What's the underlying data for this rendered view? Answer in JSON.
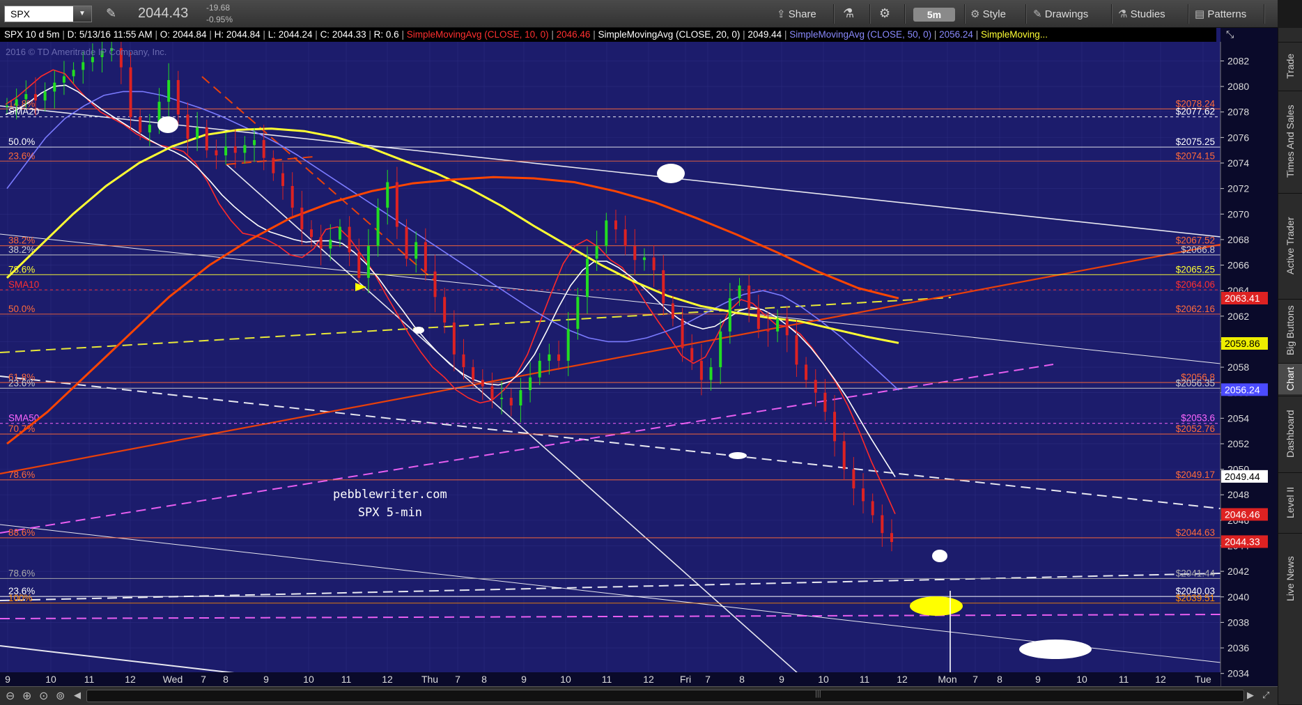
{
  "toolbar": {
    "symbol": "SPX",
    "last_price": "2044.43",
    "change": "-19.68",
    "change_pct": "-0.95%",
    "share_label": "Share",
    "interval_label": "5m",
    "style_label": "Style",
    "drawings_label": "Drawings",
    "studies_label": "Studies",
    "patterns_label": "Patterns"
  },
  "header": {
    "text": "SPX 10 d 5m",
    "date": "D: 5/13/16 11:55 AM",
    "open": "O: 2044.84",
    "high": "H: 2044.84",
    "low": "L: 2044.24",
    "close": "C: 2044.33",
    "range": "R: 0.6",
    "sma10_label": "SimpleMovingAvg (CLOSE, 10, 0)",
    "sma10_value": "2046.46",
    "sma20_label": "SimpleMovingAvg (CLOSE, 20, 0)",
    "sma20_value": "2049.44",
    "sma50_label": "SimpleMovingAvg (CLOSE, 50, 0)",
    "sma50_value": "2056.24",
    "sma_more": "SimpleMoving..."
  },
  "copyright": "2016 © TD Ameritrade IP Company, Inc.",
  "watermark": {
    "line1": "pebblewriter.com",
    "line2": "SPX 5-min"
  },
  "colors": {
    "background": "#1c1c6c",
    "sma10": "#ff2a2a",
    "sma20": "#ffffff",
    "sma50": "#7b7bff",
    "sma100": "#ffff33",
    "sma200": "#ff4500",
    "fib_line": "#ff6a3a",
    "magenta": "#ff66ff"
  },
  "side_tabs": [
    "Trade",
    "Times And Sales",
    "Active Trader",
    "Big Buttons",
    "Chart",
    "Dashboard",
    "Level II",
    "Live News"
  ],
  "active_side_tab": "Chart",
  "chart_data": {
    "type": "line",
    "title": "SPX 10 d 5m",
    "y_ticks": [
      "2082",
      "2080",
      "2078",
      "2076",
      "2074",
      "2072",
      "2070",
      "2068",
      "2066",
      "2064",
      "2062",
      "2060",
      "2058",
      "2056",
      "2054",
      "2052",
      "2050",
      "2048",
      "2046",
      "2044",
      "2042",
      "2040",
      "2038",
      "2036",
      "2034"
    ],
    "ylim": [
      2033.0,
      2083.5
    ],
    "x_ticks": [
      "9",
      "10",
      "11",
      "12",
      "Wed",
      "7",
      "8",
      "9",
      "10",
      "11",
      "12",
      "Thu",
      "7",
      "8",
      "9",
      "10",
      "11",
      "12",
      "Fri",
      "7",
      "8",
      "9",
      "10",
      "11",
      "12",
      "Mon",
      "7",
      "8",
      "9",
      "10",
      "11",
      "12",
      "Tue"
    ],
    "price_tags": [
      {
        "value": 2063.41,
        "label": "2063.41",
        "color": "#dd2222"
      },
      {
        "value": 2059.86,
        "label": "2059.86",
        "color": "#eeee00"
      },
      {
        "value": 2056.24,
        "label": "2056.24",
        "color": "#4b4bff"
      },
      {
        "value": 2049.44,
        "label": "2049.44",
        "color": "#ffffff"
      },
      {
        "value": 2046.46,
        "label": "2046.46",
        "color": "#dd2222"
      },
      {
        "value": 2044.33,
        "label": "2044.33",
        "color": "#dd2222"
      }
    ],
    "levels": [
      {
        "value": 2078.24,
        "label": "$2078.24",
        "left_label": "14.8%",
        "color": "#ff6a3a",
        "dash": false
      },
      {
        "value": 2077.62,
        "label": "$2077.62",
        "left_label": "SMA20",
        "color": "#ffffff",
        "dash": true
      },
      {
        "value": 2075.25,
        "label": "$2075.25",
        "left_label": "50.0%",
        "color": "#ffffff",
        "dash": false
      },
      {
        "value": 2074.15,
        "label": "$2074.15",
        "left_label": "23.6%",
        "color": "#ff6a3a",
        "dash": false
      },
      {
        "value": 2067.52,
        "label": "$2067.52",
        "left_label": "38.2%",
        "color": "#ff6a3a",
        "dash": false
      },
      {
        "value": 2066.8,
        "label": "$2066.8",
        "left_label": "38.2%",
        "color": "#cccccc",
        "dash": false
      },
      {
        "value": 2065.25,
        "label": "$2065.25",
        "left_label": "78.6%",
        "color": "#ffff33",
        "dash": false
      },
      {
        "value": 2064.06,
        "label": "$2064.06",
        "left_label": "SMA10",
        "color": "#ff3030",
        "dash": true
      },
      {
        "value": 2062.16,
        "label": "$2062.16",
        "left_label": "50.0%",
        "color": "#ff6a3a",
        "dash": false
      },
      {
        "value": 2056.8,
        "label": "$2056.8",
        "left_label": "61.8%",
        "color": "#ff6a3a",
        "dash": false
      },
      {
        "value": 2056.35,
        "label": "$2056.35",
        "left_label": "23.6%",
        "color": "#cccccc",
        "dash": false
      },
      {
        "value": 2053.6,
        "label": "$2053.6",
        "left_label": "SMA50",
        "color": "#ff66ff",
        "dash": true
      },
      {
        "value": 2052.76,
        "label": "$2052.76",
        "left_label": "70.7%",
        "color": "#ff6a3a",
        "dash": false
      },
      {
        "value": 2049.17,
        "label": "$2049.17",
        "left_label": "78.6%",
        "color": "#ff6a3a",
        "dash": false
      },
      {
        "value": 2044.63,
        "label": "$2044.63",
        "left_label": "88.6%",
        "color": "#ff6a3a",
        "dash": false
      },
      {
        "value": 2041.44,
        "label": "$2041.44",
        "left_label": "78.6%",
        "color": "#aaaaaa",
        "dash": false
      },
      {
        "value": 2040.03,
        "label": "$2040.03",
        "left_label": "23.6%",
        "color": "#ffffff",
        "dash": false
      },
      {
        "value": 2039.51,
        "label": "$2039.51",
        "left_label": "100%",
        "color": "#ff8a00",
        "dash": false
      }
    ],
    "candles": [
      2078.5,
      2079.0,
      2079.4,
      2078.9,
      2079.6,
      2080.3,
      2080.8,
      2081.3,
      2081.9,
      2082.3,
      2082.8,
      2083.0,
      2081.5,
      2077.6,
      2076.4,
      2077.0,
      2078.8,
      2080.5,
      2077.8,
      2075.9,
      2076.8,
      2075.0,
      2074.6,
      2075.3,
      2074.8,
      2075.4,
      2075.8,
      2074.4,
      2073.2,
      2072.2,
      2070.5,
      2068.8,
      2068.2,
      2067.3,
      2068.0,
      2069.0,
      2067.0,
      2065.0,
      2067.5,
      2070.5,
      2072.5,
      2069.0,
      2066.5,
      2067.8,
      2065.5,
      2063.5,
      2061.5,
      2059.0,
      2058.0,
      2057.0,
      2056.5,
      2055.5,
      2055.6,
      2055.0,
      2056.2,
      2057.2,
      2058.5,
      2059.0,
      2058.5,
      2061.0,
      2063.5,
      2066.5,
      2067.5,
      2069.5,
      2068.8,
      2067.5,
      2066.4,
      2066.6,
      2065.6,
      2063.0,
      2061.8,
      2059.5,
      2058.5,
      2057.0,
      2058.0,
      2060.8,
      2063.4,
      2064.4,
      2062.6,
      2061.0,
      2060.8,
      2061.8,
      2060.5,
      2058.2,
      2057.0,
      2056.0,
      2054.5,
      2052.2,
      2050.0,
      2048.5,
      2047.5,
      2046.4,
      2045.0,
      2044.3
    ],
    "series": [
      {
        "name": "SimpleMovingAvg (CLOSE, 10, 0)",
        "color": "#ff2a2a",
        "values": [
          2078.6,
          2079.2,
          2080.0,
          2080.8,
          2081.3,
          2081.0,
          2079.9,
          2078.9,
          2078.0,
          2077.5,
          2077.0,
          2076.3,
          2075.8,
          2075.4,
          2075.2,
          2074.9,
          2074.0,
          2072.6,
          2070.8,
          2069.5,
          2068.5,
          2068.3,
          2068.0,
          2067.5,
          2066.8,
          2066.6,
          2067.3,
          2068.8,
          2069.0,
          2068.1,
          2066.8,
          2065.5,
          2063.8,
          2062.2,
          2060.6,
          2059.2,
          2058.0,
          2057.2,
          2056.2,
          2055.6,
          2055.2,
          2055.4,
          2056.2,
          2057.3,
          2059.0,
          2061.4,
          2063.8,
          2066.1,
          2067.5,
          2068.0,
          2067.4,
          2066.4,
          2065.8,
          2064.5,
          2063.0,
          2061.6,
          2060.3,
          2058.9,
          2058.3,
          2058.8,
          2060.5,
          2062.4,
          2063.3,
          2063.0,
          2062.1,
          2061.3,
          2061.2,
          2060.6,
          2059.5,
          2058.2,
          2056.8,
          2055.0,
          2052.9,
          2050.6,
          2048.6,
          2046.5
        ]
      },
      {
        "name": "SimpleMovingAvg (CLOSE, 20, 0)",
        "color": "#ffffff",
        "values": [
          2077.8,
          2078.2,
          2078.8,
          2079.5,
          2080.0,
          2080.1,
          2079.6,
          2078.9,
          2078.2,
          2077.6,
          2077.0,
          2076.4,
          2075.8,
          2075.3,
          2074.9,
          2074.4,
          2073.6,
          2072.6,
          2071.5,
          2070.6,
          2069.8,
          2069.1,
          2068.6,
          2068.3,
          2068.0,
          2067.8,
          2067.9,
          2067.9,
          2067.7,
          2067.0,
          2066.1,
          2065.0,
          2063.7,
          2062.5,
          2061.2,
          2060.1,
          2059.1,
          2058.2,
          2057.5,
          2057.0,
          2056.7,
          2056.6,
          2056.9,
          2057.7,
          2059.0,
          2060.8,
          2062.7,
          2064.4,
          2065.6,
          2066.3,
          2066.3,
          2065.8,
          2065.1,
          2064.3,
          2063.4,
          2062.5,
          2061.8,
          2061.3,
          2061.0,
          2061.2,
          2061.8,
          2062.4,
          2062.7,
          2062.5,
          2062.0,
          2061.3,
          2060.5,
          2059.5,
          2058.3,
          2057.0,
          2055.6,
          2054.0,
          2052.4,
          2050.9,
          2049.4
        ]
      },
      {
        "name": "SimpleMovingAvg (CLOSE, 50, 0)",
        "color": "#7b7bff",
        "values": [
          2072.0,
          2074.0,
          2076.0,
          2077.5,
          2078.5,
          2079.3,
          2079.6,
          2079.6,
          2079.3,
          2078.8,
          2078.3,
          2077.7,
          2077.0,
          2076.3,
          2075.5,
          2074.6,
          2073.6,
          2072.6,
          2071.6,
          2070.6,
          2069.6,
          2068.6,
          2067.6,
          2066.6,
          2065.6,
          2064.6,
          2063.6,
          2062.6,
          2061.7,
          2060.9,
          2060.3,
          2060.0,
          2060.0,
          2060.3,
          2060.8,
          2061.4,
          2062.2,
          2063.0,
          2063.7,
          2064.0,
          2063.6,
          2062.7,
          2061.6,
          2060.4,
          2059.0,
          2057.6,
          2056.2
        ]
      },
      {
        "name": "SMA100",
        "color": "#ffff33",
        "values": [
          2065.0,
          2067.5,
          2070.0,
          2072.2,
          2074.0,
          2075.3,
          2076.2,
          2076.6,
          2076.7,
          2076.5,
          2076.0,
          2075.2,
          2074.2,
          2073.2,
          2072.0,
          2070.6,
          2069.0,
          2067.5,
          2066.0,
          2064.7,
          2063.6,
          2062.8,
          2062.3,
          2061.9,
          2061.6,
          2061.0,
          2060.4,
          2059.9
        ]
      },
      {
        "name": "SMA200",
        "color": "#ff4500",
        "values": [
          2052.0,
          2054.5,
          2057.5,
          2060.5,
          2063.5,
          2066.0,
          2068.0,
          2069.7,
          2070.9,
          2071.8,
          2072.4,
          2072.7,
          2072.9,
          2072.8,
          2072.5,
          2071.8,
          2070.9,
          2069.7,
          2068.4,
          2067.0,
          2065.5,
          2064.2,
          2063.4
        ]
      }
    ]
  }
}
